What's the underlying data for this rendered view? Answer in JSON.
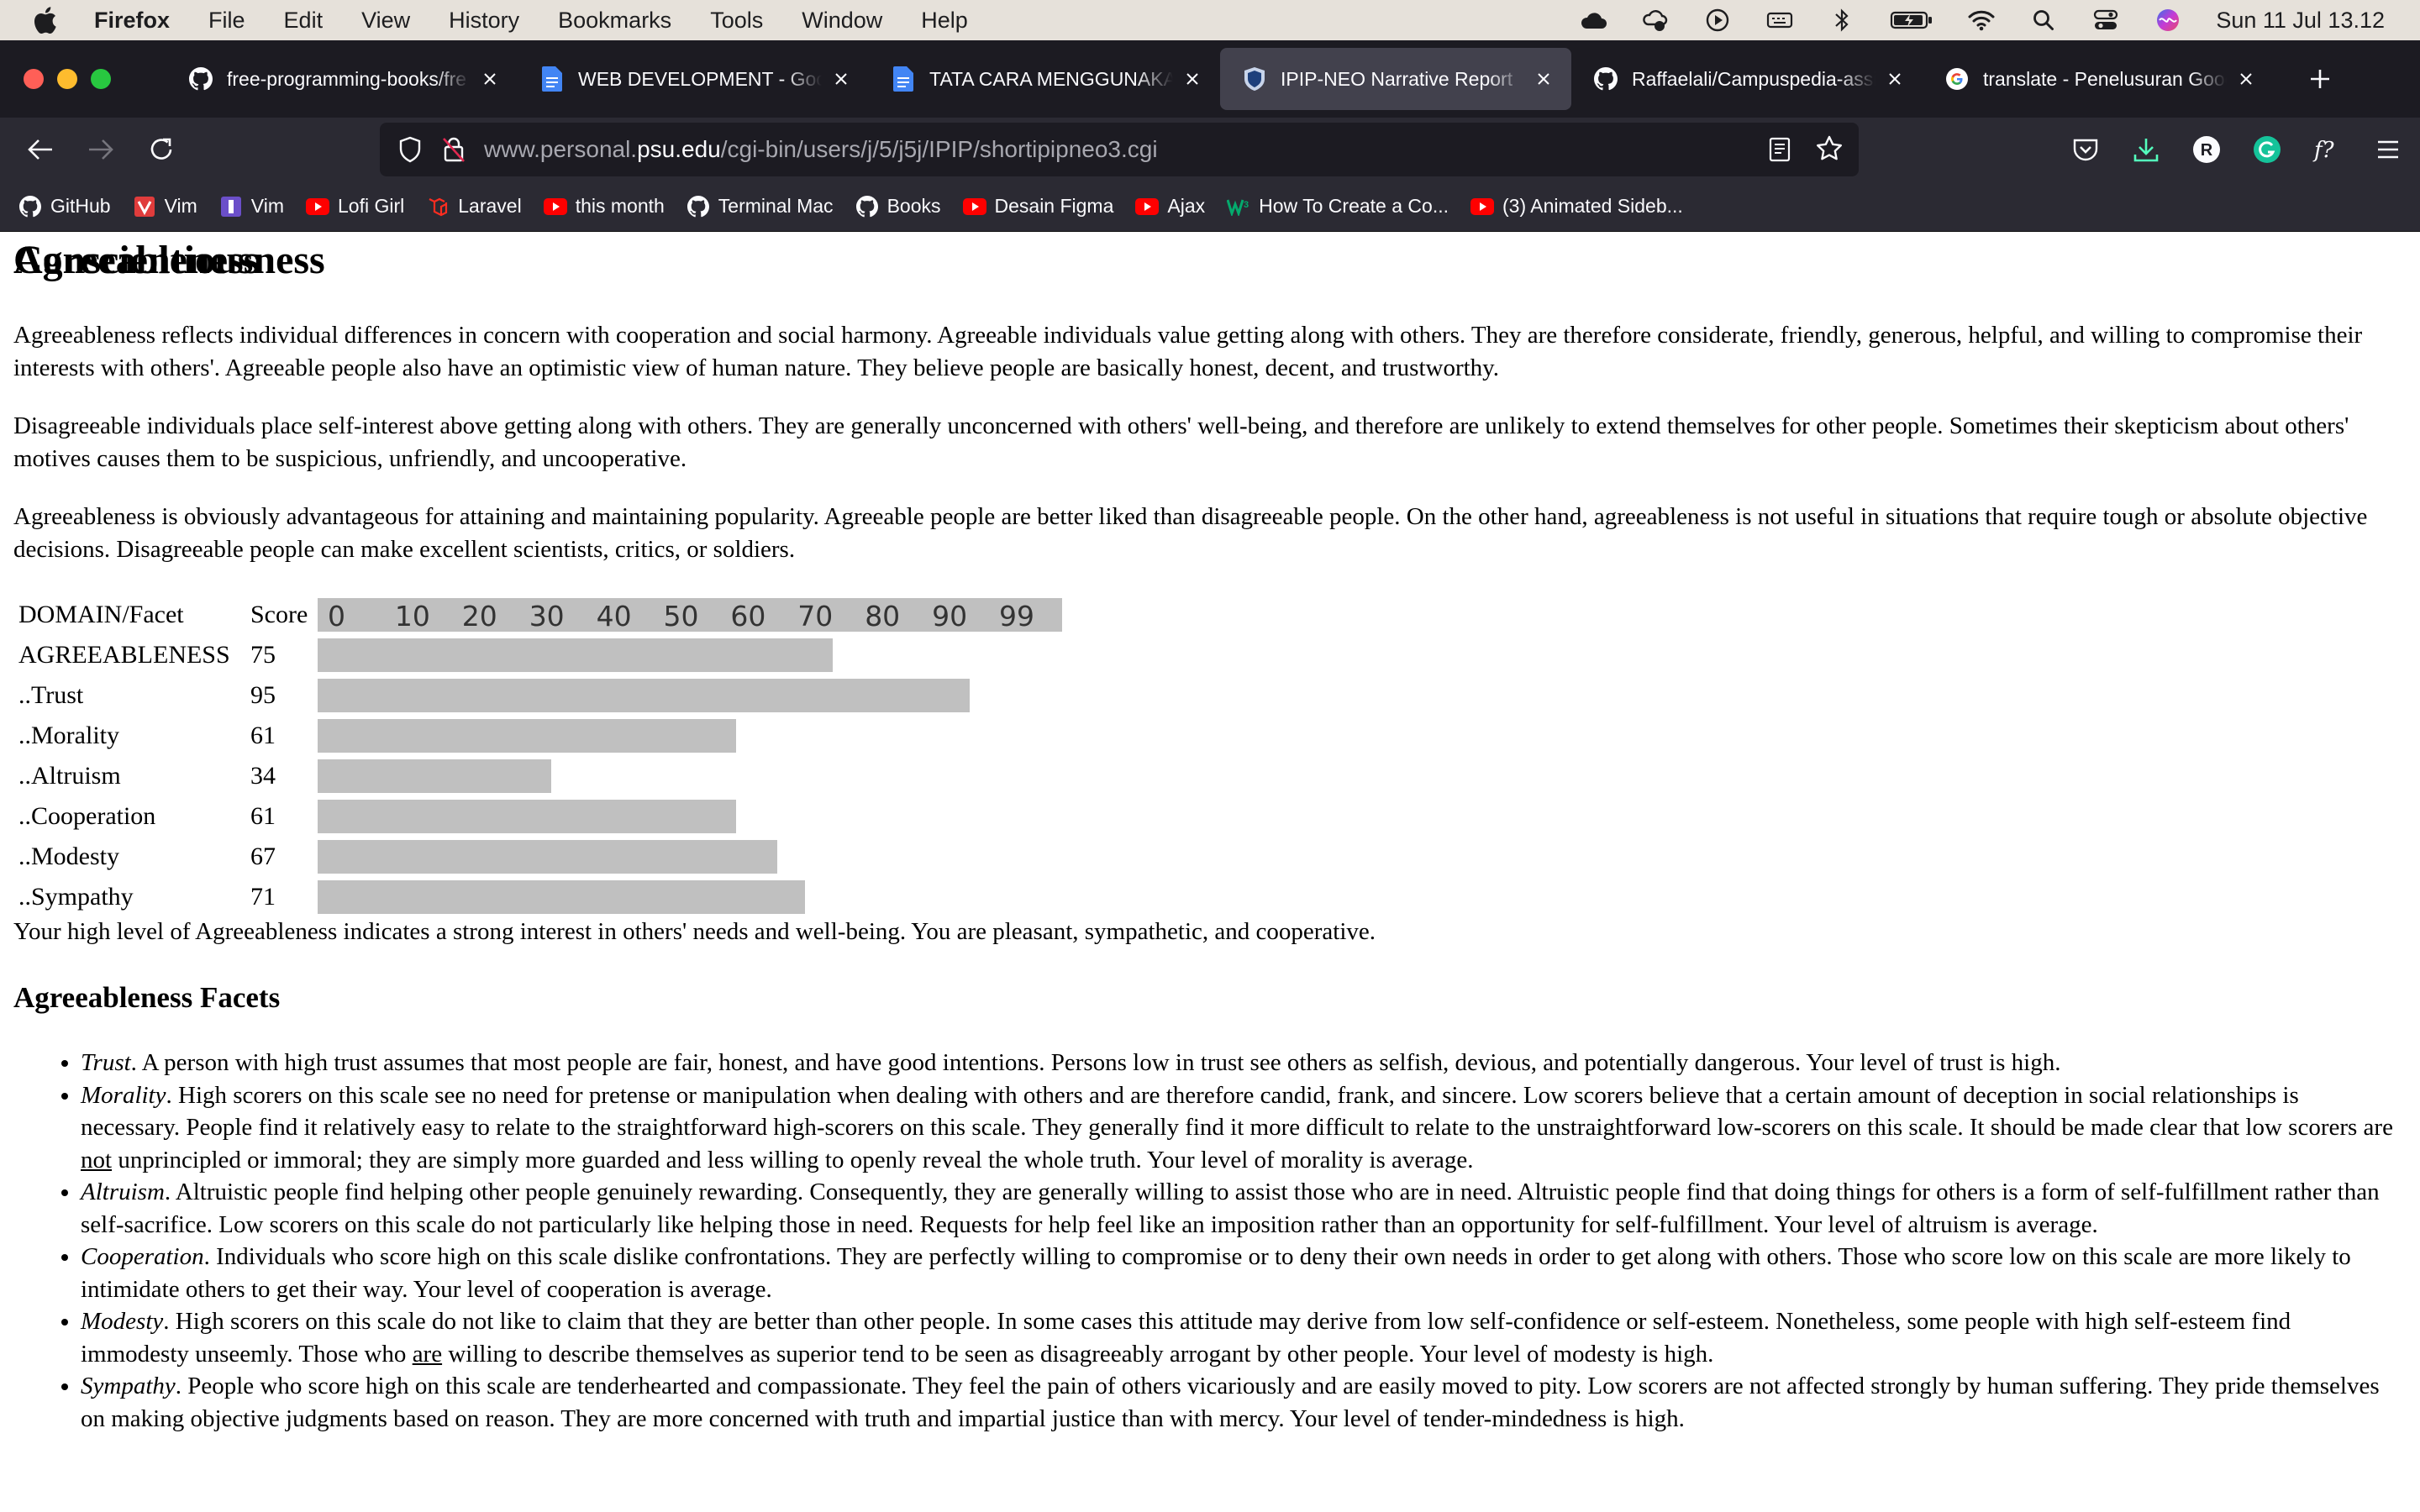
{
  "menubar": {
    "app": "Firefox",
    "menus": [
      "File",
      "Edit",
      "View",
      "History",
      "Bookmarks",
      "Tools",
      "Window",
      "Help"
    ],
    "clock": "Sun 11 Jul  13.12"
  },
  "tabs": [
    {
      "title": "free-programming-books/fre",
      "icon": "github-icon"
    },
    {
      "title": "WEB DEVELOPMENT - Google",
      "icon": "google-docs-icon"
    },
    {
      "title": "TATA CARA MENGGUNAKAN",
      "icon": "google-docs-icon"
    },
    {
      "title": "IPIP-NEO Narrative Report",
      "icon": "psu-shield-icon"
    },
    {
      "title": "Raffaelali/Campuspedia-assi",
      "icon": "github-icon"
    },
    {
      "title": "translate - Penelusuran Goog",
      "icon": "google-icon"
    }
  ],
  "url": {
    "prefix": "www.personal.",
    "host": "psu.edu",
    "path": "/cgi-bin/users/j/5/j5j/IPIP/shortipipneo3.cgi"
  },
  "bookmarks": [
    "GitHub",
    "Vim",
    "Vim",
    "Lofi Girl",
    "Laravel",
    "this month",
    "Terminal Mac",
    "Books",
    "Desain Figma",
    "Ajax",
    "How To Create a Co...",
    "(3) Animated Sideb..."
  ],
  "page": {
    "heading": "Agreeableness",
    "para1": "Agreeableness reflects individual differences in concern with cooperation and social harmony. Agreeable individuals value getting along with others. They are therefore considerate, friendly, generous, helpful, and willing to compromise their interests with others'. Agreeable people also have an optimistic view of human nature. They believe people are basically honest, decent, and trustworthy.",
    "para2": "Disagreeable individuals place self-interest above getting along with others. They are generally unconcerned with others' well-being, and therefore are unlikely to extend themselves for other people. Sometimes their skepticism about others' motives causes them to be suspicious, unfriendly, and uncooperative.",
    "para3": "Agreeableness is obviously advantageous for attaining and maintaining popularity. Agreeable people are better liked than disagreeable people. On the other hand, agreeableness is not useful in situations that require tough or absolute objective decisions. Disagreeable people can make excellent scientists, critics, or soldiers.",
    "table": {
      "col1": "DOMAIN/Facet",
      "col2": "Score",
      "scale": [
        "0",
        "10",
        "20",
        "30",
        "40",
        "50",
        "60",
        "70",
        "80",
        "90",
        "99"
      ],
      "rows": [
        {
          "label": "AGREEABLENESS",
          "score": 75
        },
        {
          "label": "..Trust",
          "score": 95
        },
        {
          "label": "..Morality",
          "score": 61
        },
        {
          "label": "..Altruism",
          "score": 34
        },
        {
          "label": "..Cooperation",
          "score": 61
        },
        {
          "label": "..Modesty",
          "score": 67
        },
        {
          "label": "..Sympathy",
          "score": 71
        }
      ]
    },
    "summary": "Your high level of Agreeableness indicates a strong interest in others' needs and well-being. You are pleasant, sympathetic, and cooperative.",
    "facets_heading": "Agreeableness Facets",
    "facets": [
      {
        "name": "Trust",
        "text": ". A person with high trust assumes that most people are fair, honest, and have good intentions. Persons low in trust see others as selfish, devious, and potentially dangerous. Your level of trust is high."
      },
      {
        "name": "Morality",
        "text": ". High scorers on this scale see no need for pretense or manipulation when dealing with others and are therefore candid, frank, and sincere. Low scorers believe that a certain amount of deception in social relationships is necessary. People find it relatively easy to relate to the straightforward high-scorers on this scale. They generally find it more difficult to relate to the unstraightforward low-scorers on this scale. It should be made clear that low scorers are ",
        "underlined": "not",
        "text2": " unprincipled or immoral; they are simply more guarded and less willing to openly reveal the whole truth. Your level of morality is average."
      },
      {
        "name": "Altruism",
        "text": ". Altruistic people find helping other people genuinely rewarding. Consequently, they are generally willing to assist those who are in need. Altruistic people find that doing things for others is a form of self-fulfillment rather than self-sacrifice. Low scorers on this scale do not particularly like helping those in need. Requests for help feel like an imposition rather than an opportunity for self-fulfillment. Your level of altruism is average."
      },
      {
        "name": "Cooperation",
        "text": ". Individuals who score high on this scale dislike confrontations. They are perfectly willing to compromise or to deny their own needs in order to get along with others. Those who score low on this scale are more likely to intimidate others to get their way. Your level of cooperation is average."
      },
      {
        "name": "Modesty",
        "text": ". High scorers on this scale do not like to claim that they are better than other people. In some cases this attitude may derive from low self-confidence or self-esteem. Nonetheless, some people with high self-esteem find immodesty unseemly. Those who ",
        "underlined": "are",
        "text2": " willing to describe themselves as superior tend to be seen as disagreeably arrogant by other people. Your level of modesty is high."
      },
      {
        "name": "Sympathy",
        "text": ". People who score high on this scale are tenderhearted and compassionate. They feel the pain of others vicariously and are easily moved to pity. Low scorers are not affected strongly by human suffering. They pride themselves on making objective judgments based on reason. They are more concerned with truth and impartial justice than with mercy. Your level of tender-mindedness is high."
      }
    ],
    "next_heading": "Conscientiousness"
  },
  "colors": {
    "bar": "#c0c0c0",
    "tabstrip": "#1c1b22",
    "toolbar": "#2b2a33",
    "active_tab": "#42414d"
  }
}
